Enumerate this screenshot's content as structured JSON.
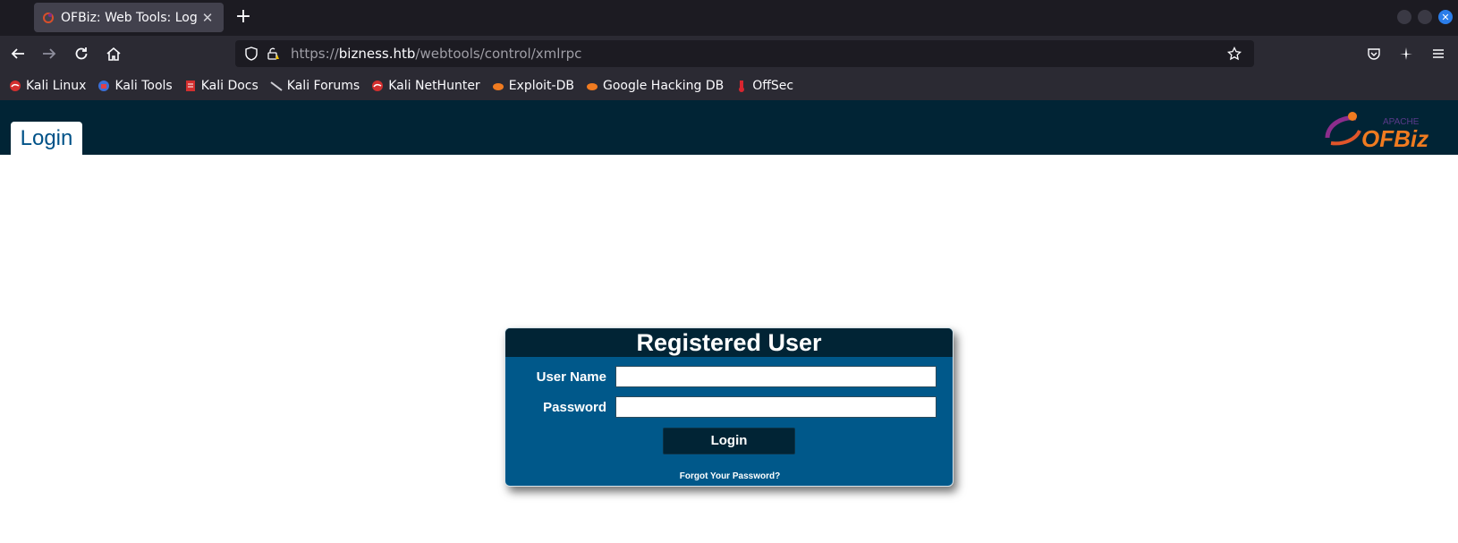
{
  "browser": {
    "tab_title": "OFBiz: Web Tools: Login",
    "url_host": "bizness.htb",
    "url_scheme": "https://",
    "url_path": "/webtools/control/xmlrpc",
    "bookmarks": [
      {
        "label": "Kali Linux",
        "icon": "kali-icon"
      },
      {
        "label": "Kali Tools",
        "icon": "kali-tools-icon"
      },
      {
        "label": "Kali Docs",
        "icon": "kali-docs-icon"
      },
      {
        "label": "Kali Forums",
        "icon": "kali-forums-icon"
      },
      {
        "label": "Kali NetHunter",
        "icon": "nethunter-icon"
      },
      {
        "label": "Exploit-DB",
        "icon": "exploit-db-icon"
      },
      {
        "label": "Google Hacking DB",
        "icon": "ghdb-icon"
      },
      {
        "label": "OffSec",
        "icon": "offsec-icon"
      }
    ]
  },
  "header": {
    "login_tab": "Login",
    "logo_small": "APACHE",
    "logo_main": "OFBiz"
  },
  "login": {
    "title": "Registered User",
    "username_label": "User Name",
    "username_value": "",
    "password_label": "Password",
    "password_value": "",
    "button_label": "Login",
    "forgot_label": "Forgot Your Password?"
  },
  "colors": {
    "header_bg": "#012435",
    "box_bg": "#00588a",
    "accent": "#005288"
  }
}
